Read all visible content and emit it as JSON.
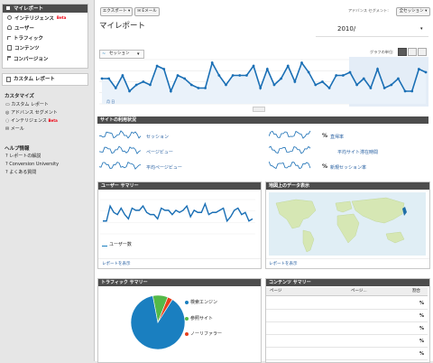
{
  "sidebar": {
    "my_report": "マイレポート",
    "items": [
      {
        "label": "インテリジェンス",
        "beta": "Beta"
      },
      {
        "label": "ユーザー"
      },
      {
        "label": "トラフィック"
      },
      {
        "label": "コンテンツ"
      },
      {
        "label": "コンバージョン"
      }
    ],
    "custom_report": "カスタム レポート",
    "customize": {
      "title": "カスタマイズ",
      "items": [
        {
          "label": "カスタム レポート"
        },
        {
          "label": "アドバンス セグメント"
        },
        {
          "label": "インテリジェンス",
          "beta": "Beta"
        },
        {
          "label": "メール"
        }
      ]
    },
    "help": {
      "title": "ヘルプ情報",
      "items": [
        {
          "label": "レポートの解説"
        },
        {
          "label": "Conversion University"
        },
        {
          "label": "よくある質問"
        }
      ]
    }
  },
  "toolbar": {
    "export_label": "エクスポート ▾",
    "email_label": "✉ Eメール",
    "segment_label": "アドバンス セグメント:",
    "segment_value": "全セッション ▾"
  },
  "page": {
    "title": "マイレポート",
    "date": "2010/"
  },
  "graph": {
    "metric_label": "セッション",
    "by_label": "グラフの単位:",
    "annotation": "月 日"
  },
  "site_usage": {
    "title": "サイトの利用状況",
    "metrics": [
      {
        "label": "セッション"
      },
      {
        "label": "ページビュー"
      },
      {
        "label": "平均ページビュー"
      },
      {
        "label": "直帰率"
      },
      {
        "label": "平均サイト滞在時間"
      },
      {
        "label": "新規セッション率"
      }
    ],
    "pct": "%"
  },
  "visitor_overview": {
    "title": "ユーザー サマリー",
    "legend": "ユーザー数",
    "link": "レポートを表示"
  },
  "map_overview": {
    "title": "地図上のデータ表示",
    "link": "レポートを表示"
  },
  "traffic_overview": {
    "title": "トラフィック サマリー",
    "legend": [
      {
        "label": "検索エンジン",
        "color": "#1a7fc0"
      },
      {
        "label": "参照サイト",
        "color": "#54b948"
      },
      {
        "label": "ノーリファラー",
        "color": "#e8401c"
      }
    ]
  },
  "content_overview": {
    "title": "コンテンツ サマリー",
    "col_page": "ページ",
    "col_pageviews": "ページ...",
    "col_pct": "割合",
    "rows": [
      {
        "pct": "%"
      },
      {
        "pct": "%"
      },
      {
        "pct": "%"
      },
      {
        "pct": "%"
      },
      {
        "pct": "%"
      }
    ]
  },
  "chart_data": [
    {
      "type": "line",
      "series": [
        {
          "name": "セッション",
          "values": [
            40,
            40,
            25,
            45,
            20,
            30,
            35,
            30,
            60,
            55,
            20,
            45,
            40,
            30,
            25,
            25,
            65,
            45,
            30,
            45,
            45,
            45,
            60,
            25,
            55,
            30,
            40,
            60,
            35,
            65,
            50,
            30,
            35,
            25,
            45,
            45,
            50,
            30,
            40,
            25,
            55,
            25,
            30,
            40,
            20,
            20,
            55,
            50
          ]
        }
      ],
      "ylim": [
        0,
        70
      ],
      "grid": true
    },
    {
      "type": "line",
      "series": [
        {
          "name": "ユーザー数",
          "values": [
            30,
            30,
            65,
            50,
            45,
            60,
            45,
            35,
            60,
            55,
            55,
            65,
            50,
            45,
            45,
            35,
            60,
            55,
            55,
            45,
            55,
            50,
            55,
            65,
            40,
            55,
            50,
            50,
            70,
            45,
            50,
            50,
            55,
            60,
            30,
            40,
            55,
            60,
            45,
            50,
            30,
            35
          ]
        }
      ],
      "ylim": [
        0,
        80
      ]
    },
    {
      "type": "pie",
      "categories": [
        "検索エンジン",
        "参照サイト",
        "ノーリファラー"
      ],
      "values": [
        88,
        9,
        3
      ]
    }
  ]
}
